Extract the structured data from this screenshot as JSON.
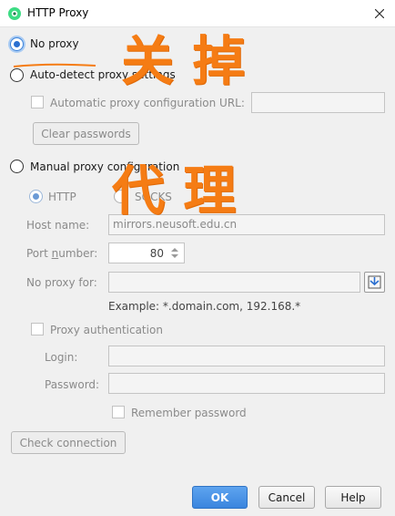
{
  "window": {
    "title": "HTTP Proxy",
    "app_icon": "android-studio-icon",
    "close_icon": "close-icon"
  },
  "proxy_mode": {
    "no_proxy": {
      "label": "No proxy",
      "selected": true
    },
    "auto_detect": {
      "label": "Auto-detect proxy settings",
      "selected": false
    },
    "manual": {
      "label": "Manual proxy configuration",
      "selected": false
    }
  },
  "auto": {
    "pac_checkbox_label": "Automatic proxy configuration URL:",
    "pac_url_value": "",
    "clear_passwords_label": "Clear passwords"
  },
  "manual": {
    "type_http_label": "HTTP",
    "type_socks_label": "SOCKS",
    "host_label": "Host name:",
    "host_value": "mirrors.neusoft.edu.cn",
    "port_label": "Port number:",
    "port_value": "80",
    "no_proxy_label": "No proxy for:",
    "no_proxy_value": "",
    "no_proxy_hint": "Example: *.domain.com, 192.168.*",
    "auth_label": "Proxy authentication",
    "login_label": "Login:",
    "login_value": "",
    "password_label": "Password:",
    "password_value": "",
    "remember_label": "Remember password"
  },
  "footer": {
    "check_connection_label": "Check connection",
    "ok_label": "OK",
    "cancel_label": "Cancel",
    "help_label": "Help"
  },
  "annotations": {
    "top": "关 掉",
    "bottom": "代 理"
  },
  "colors": {
    "annotation": "#f57c14",
    "accent": "#3a85de"
  }
}
